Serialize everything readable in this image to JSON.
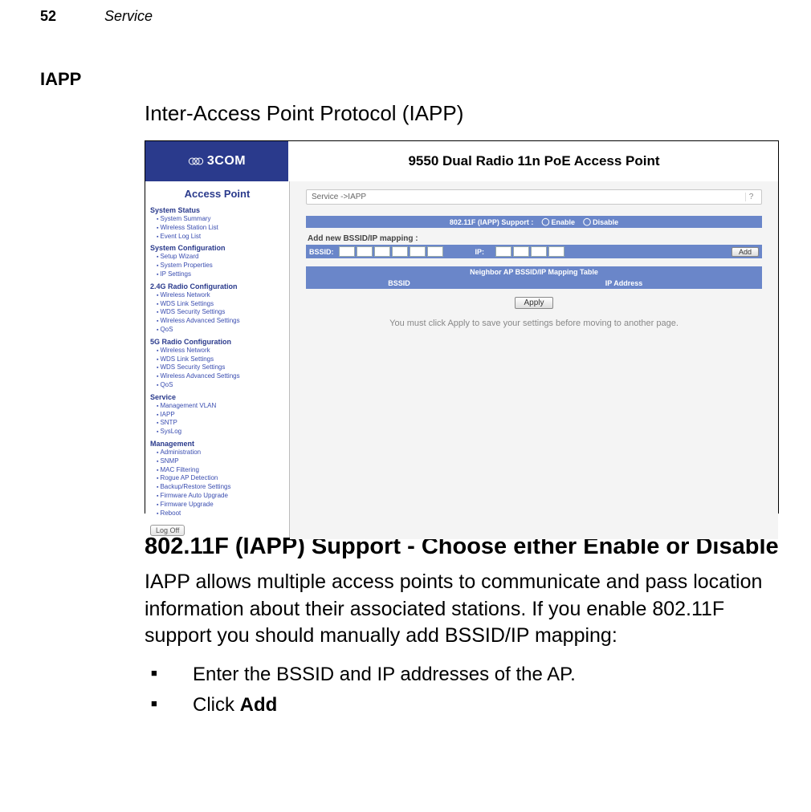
{
  "header": {
    "page_number": "52",
    "running_title": "Service"
  },
  "section": {
    "heading": "IAPP",
    "intro": "Inter-Access Point Protocol (IAPP)"
  },
  "screenshot": {
    "logo_text": "3COM",
    "product_title": "9550 Dual Radio 11n PoE Access Point",
    "sidebar_title": "Access Point",
    "groups": [
      {
        "title": "System Status",
        "items": [
          "System Summary",
          "Wireless Station List",
          "Event Log List"
        ]
      },
      {
        "title": "System Configuration",
        "items": [
          "Setup Wizard",
          "System Properties",
          "IP Settings"
        ]
      },
      {
        "title": "2.4G Radio Configuration",
        "items": [
          "Wireless Network",
          "WDS Link Settings",
          "WDS Security Settings",
          "Wireless Advanced Settings",
          "QoS"
        ]
      },
      {
        "title": "5G Radio Configuration",
        "items": [
          "Wireless Network",
          "WDS Link Settings",
          "WDS Security Settings",
          "Wireless Advanced Settings",
          "QoS"
        ]
      },
      {
        "title": "Service",
        "items": [
          "Management VLAN",
          "IAPP",
          "SNTP",
          "SysLog"
        ]
      },
      {
        "title": "Management",
        "items": [
          "Administration",
          "SNMP",
          "MAC Filtering",
          "Rogue AP Detection",
          "Backup/Restore Settings",
          "Firmware Auto Upgrade",
          "Firmware Upgrade",
          "Reboot"
        ]
      }
    ],
    "logoff": "Log Off",
    "breadcrumb": "Service ->IAPP",
    "help_symbol": "?",
    "support_bar": {
      "label": "802.11F (IAPP) Support :",
      "opt_enable": "Enable",
      "opt_disable": "Disable"
    },
    "add_mapping_label": "Add new BSSID/IP mapping :",
    "row": {
      "bssid_label": "BSSID:",
      "ip_label": "IP:",
      "add_btn": "Add"
    },
    "table": {
      "caption": "Neighbor AP BSSID/IP Mapping Table",
      "col1": "BSSID",
      "col2": "IP Address"
    },
    "apply_btn": "Apply",
    "hint": "You must click Apply to save your settings before moving to another page."
  },
  "body": {
    "h2": "802.11F (IAPP) Support - Choose either Enable or Disable",
    "para": "IAPP allows multiple access points to communicate and pass location information about their associated stations. If you enable 802.11F support you should manually add BSSID/IP mapping:",
    "bullets": [
      {
        "text": "Enter the BSSID and IP addresses of the AP."
      },
      {
        "prefix": "Click ",
        "bold": "Add"
      }
    ]
  }
}
